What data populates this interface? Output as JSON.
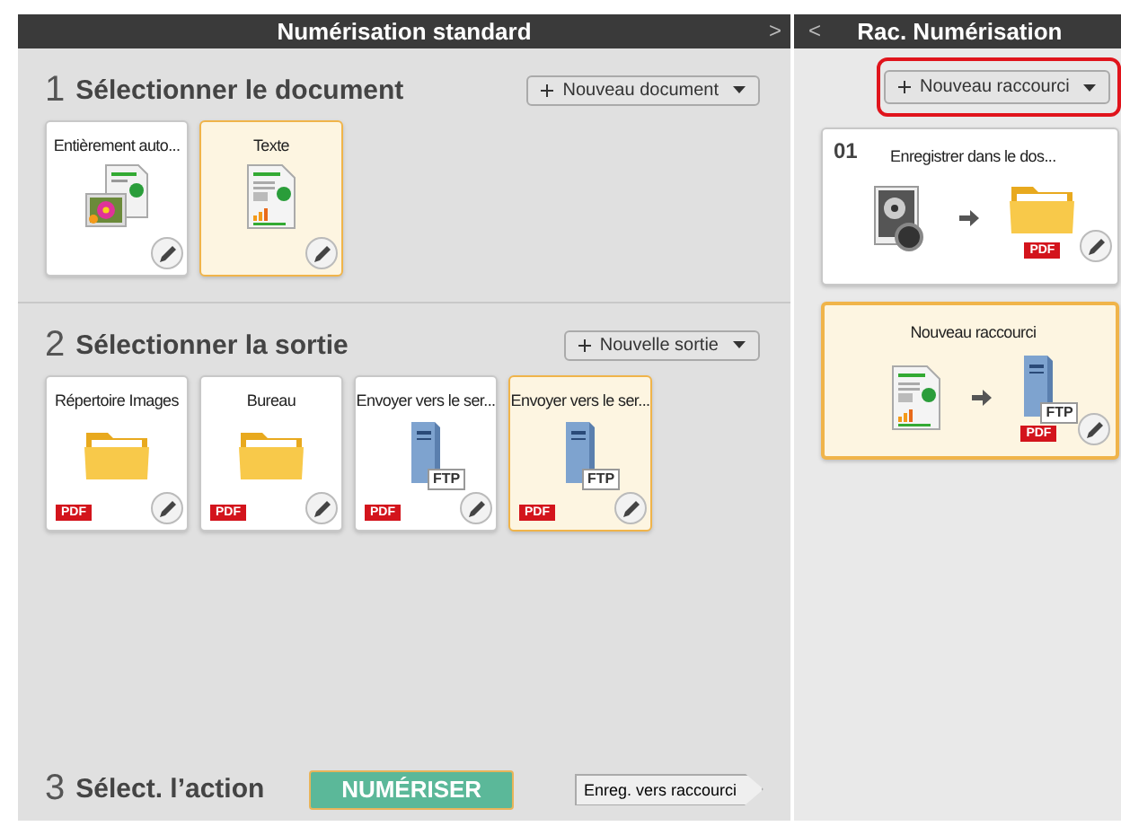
{
  "main_panel": {
    "title": "Numérisation standard",
    "collapse_glyph": ">",
    "sections": [
      {
        "number": "1",
        "title": "Sélectionner le document",
        "add_button": "Nouveau document",
        "cards": [
          {
            "label": "Entièrement auto...",
            "kind": "photo-doc",
            "selected": false
          },
          {
            "label": "Texte",
            "kind": "text-doc",
            "selected": true
          }
        ]
      },
      {
        "number": "2",
        "title": "Sélectionner la sortie",
        "add_button": "Nouvelle sortie",
        "cards": [
          {
            "label": "Répertoire Images",
            "kind": "folder",
            "format_badge": "PDF",
            "selected": false
          },
          {
            "label": "Bureau",
            "kind": "folder",
            "format_badge": "PDF",
            "selected": false
          },
          {
            "label": "Envoyer vers le ser...",
            "kind": "ftp",
            "server_badge": "FTP",
            "format_badge": "PDF",
            "selected": false
          },
          {
            "label": "Envoyer vers le ser...",
            "kind": "ftp",
            "server_badge": "FTP",
            "format_badge": "PDF",
            "selected": true
          }
        ]
      }
    ],
    "action": {
      "number": "3",
      "title": "Sélect. l’action",
      "scan_button": "NUMÉRISER",
      "save_button": "Enreg. vers raccourci"
    }
  },
  "shortcut_panel": {
    "title": "Rac. Numérisation",
    "back_glyph": "<",
    "add_button": "Nouveau raccourci",
    "add_button_highlighted": true,
    "shortcuts": [
      {
        "number": "01",
        "label": "Enregistrer dans le dos...",
        "selected": false,
        "steps": [
          {
            "kind": "gray-photo"
          },
          {
            "kind": "folder",
            "format_badge": "PDF"
          }
        ]
      },
      {
        "label": "Nouveau raccourci",
        "selected": true,
        "steps": [
          {
            "kind": "text-doc"
          },
          {
            "kind": "ftp",
            "server_badge": "FTP",
            "format_badge": "PDF"
          }
        ]
      }
    ]
  }
}
